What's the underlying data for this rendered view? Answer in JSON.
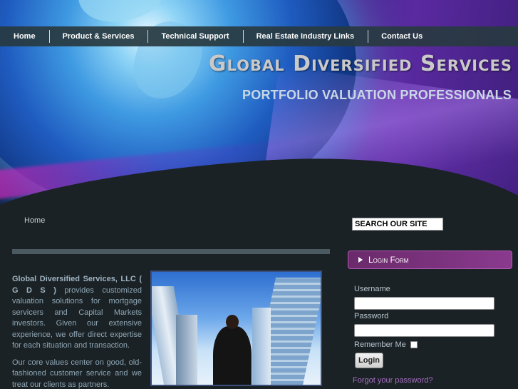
{
  "nav": {
    "items": [
      "Home",
      "Product & Services",
      "Technical Support",
      "Real Estate Industry Links",
      "Contact Us"
    ]
  },
  "header": {
    "title": "Global Diversified Services",
    "tagline": "PORTFOLIO VALUATION PROFESSIONALS"
  },
  "breadcrumb": "Home",
  "search": {
    "value": "SEARCH OUR SITE"
  },
  "main": {
    "company_name": "Global Diversified Services, LLC",
    "abbreviation": "( G D S )",
    "intro_rest": "provides customized valuation solutions for mortgage servicers and Capital Markets investors. Given our extensive experience, we offer direct expertise for each situation and transaction.",
    "paragraph2": "Our core values center on good, old-fashioned customer service and we treat our clients as partners."
  },
  "login": {
    "title": "Login Form",
    "username_label": "Username",
    "password_label": "Password",
    "remember_label": "Remember Me",
    "button_label": "Login",
    "forgot_link": "Forgot your password?"
  }
}
